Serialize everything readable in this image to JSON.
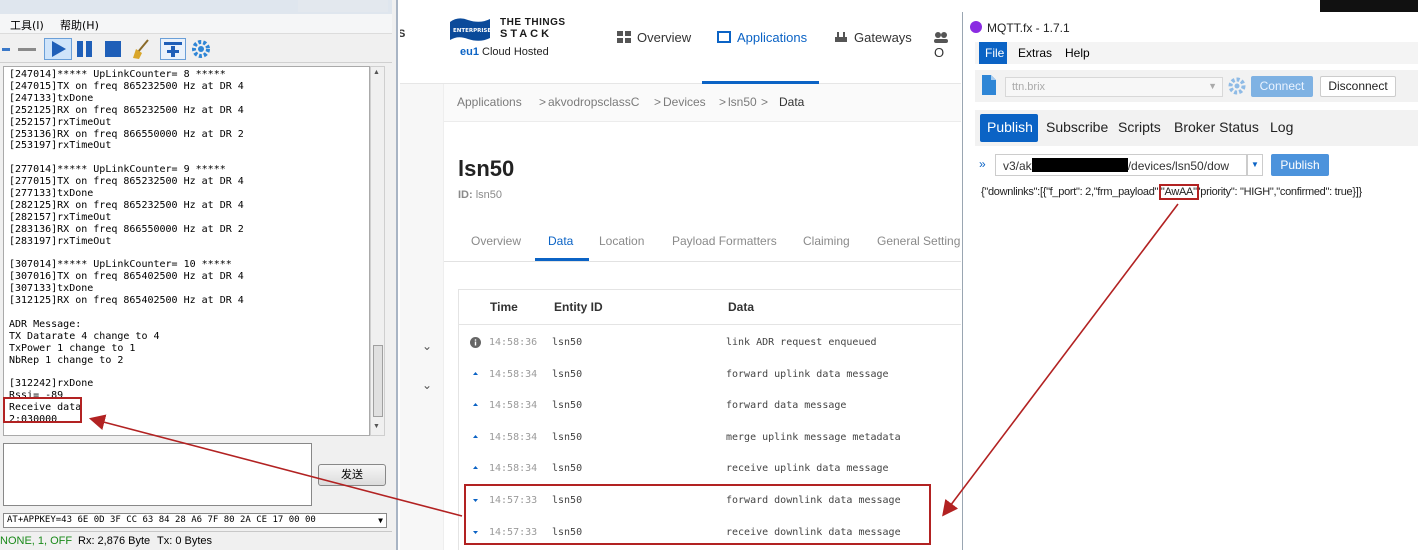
{
  "serial": {
    "menu": [
      "工具(I)",
      "帮助(H)"
    ],
    "terminal_lines": [
      "[247014]***** UpLinkCounter= 8 *****",
      "[247015]TX on freq 865232500 Hz at DR 4",
      "[247133]txDone",
      "[252125]RX on freq 865232500 Hz at DR 4",
      "[252157]rxTimeOut",
      "[253136]RX on freq 866550000 Hz at DR 2",
      "[253197]rxTimeOut",
      "",
      "[277014]***** UpLinkCounter= 9 *****",
      "[277015]TX on freq 865232500 Hz at DR 4",
      "[277133]txDone",
      "[282125]RX on freq 865232500 Hz at DR 4",
      "[282157]rxTimeOut",
      "[283136]RX on freq 866550000 Hz at DR 2",
      "[283197]rxTimeOut",
      "",
      "[307014]***** UpLinkCounter= 10 *****",
      "[307016]TX on freq 865402500 Hz at DR 4",
      "[307133]txDone",
      "[312125]RX on freq 865402500 Hz at DR 4",
      "",
      "ADR Message:",
      "TX Datarate 4 change to 4",
      "TxPower 1 change to 1",
      "NbRep 1 change to 2",
      "",
      "[312242]rxDone",
      "Rssi= -89",
      "Receive data",
      "2:030000"
    ],
    "send_label": "发送",
    "command": "AT+APPKEY=43 6E 0D 3F CC 63 84 28 A6 7F 80 2A CE 17 00 00",
    "status": [
      "NONE, 1, OFF",
      "Rx: 2,876 Byte",
      "Tx: 0 Bytes"
    ],
    "colors": {
      "highlight": "#b22222",
      "status_green": "#1a8a1a"
    }
  },
  "ttn": {
    "left_stub": "S",
    "brand_line1": "THE THINGS",
    "brand_line2": "STACK",
    "brand_badge": "ENTERPRISE",
    "region": "eu1",
    "hosting": "Cloud Hosted",
    "nav": [
      {
        "label": "Overview",
        "icon": "grid-icon"
      },
      {
        "label": "Applications",
        "icon": "applications-icon"
      },
      {
        "label": "Gateways",
        "icon": "gateway-icon"
      },
      {
        "label": "O",
        "icon": "people-icon"
      }
    ],
    "breadcrumb": [
      "Applications",
      ">",
      "akvodropsclassC",
      ">",
      "Devices",
      ">",
      "lsn50",
      ">",
      "Data"
    ],
    "device_name": "lsn50",
    "device_id_label": "ID:",
    "device_id": "lsn50",
    "tabs": [
      "Overview",
      "Data",
      "Location",
      "Payload Formatters",
      "Claiming",
      "General Setting"
    ],
    "active_tab": "Data",
    "columns": [
      "Time",
      "Entity ID",
      "Data"
    ],
    "rows": [
      {
        "time": "14:58:36",
        "entity": "lsn50",
        "data": "link ADR request enqueued",
        "icon": "info-icon"
      },
      {
        "time": "14:58:34",
        "entity": "lsn50",
        "data": "forward uplink data message",
        "icon": "arrow-up-icon"
      },
      {
        "time": "14:58:34",
        "entity": "lsn50",
        "data": "forward data message",
        "icon": "arrow-up-icon"
      },
      {
        "time": "14:58:34",
        "entity": "lsn50",
        "data": "merge uplink message metadata",
        "icon": "arrow-up-icon"
      },
      {
        "time": "14:58:34",
        "entity": "lsn50",
        "data": "receive uplink data message",
        "icon": "arrow-up-icon"
      },
      {
        "time": "14:57:33",
        "entity": "lsn50",
        "data": "forward downlink data message",
        "icon": "arrow-down-icon"
      },
      {
        "time": "14:57:33",
        "entity": "lsn50",
        "data": "receive downlink data message",
        "icon": "arrow-down-icon"
      }
    ],
    "colors": {
      "accent": "#0b63c5"
    }
  },
  "mqtt": {
    "title": "MQTT.fx - 1.7.1",
    "menu": [
      "File",
      "Extras",
      "Help"
    ],
    "profile": "ttn.brix",
    "connect": "Connect",
    "disconnect": "Disconnect",
    "sections": [
      "Publish",
      "Subscribe",
      "Scripts",
      "Broker Status",
      "Log"
    ],
    "topic_prefix": "v3/ak",
    "topic_suffix": "/devices/lsn50/dow",
    "publish": "Publish",
    "payload_pre": "{\"downlinks\":[{\"f_port\": 2,\"frm_payload\":",
    "payload_value": "\"AwAA\"",
    "payload_post": "\"priority\": \"HIGH\",\"confirmed\": true}]}",
    "colors": {
      "accent": "#0b63c5"
    }
  }
}
